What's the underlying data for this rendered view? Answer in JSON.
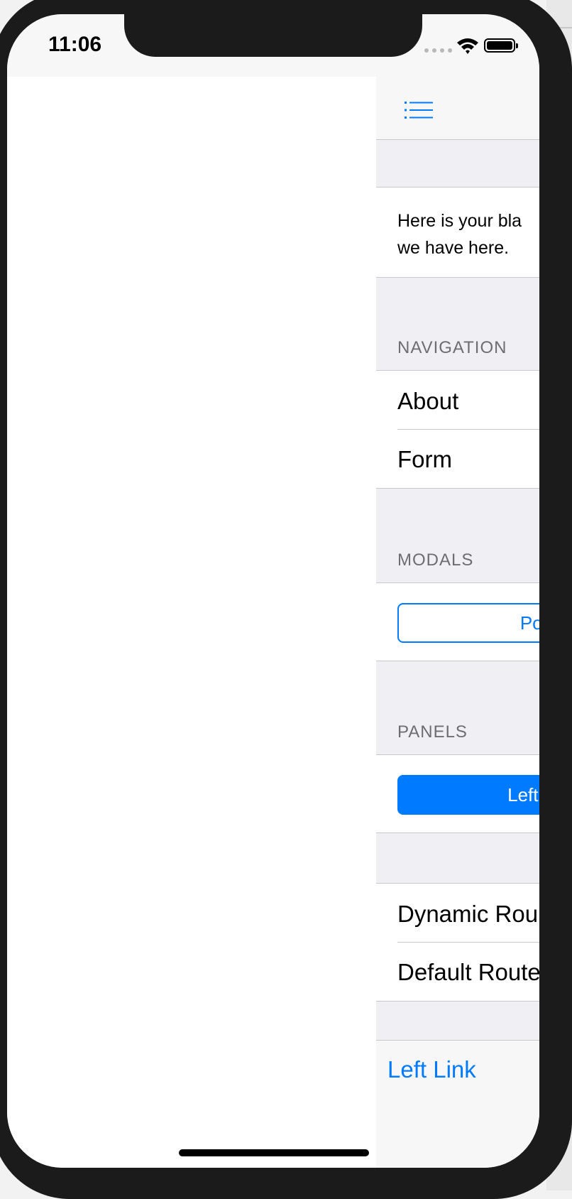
{
  "status_bar": {
    "time": "11:06"
  },
  "panel": {
    "block_text_lines": [
      "Here is your bla",
      "we have here."
    ],
    "sections": {
      "navigation": "NAVIGATION",
      "modals": "MODALS",
      "panels": "PANELS"
    },
    "navigation_items": [
      "About",
      "Form"
    ],
    "modals_button": "Popup",
    "panels_button": "Left Pan",
    "route_items": [
      "Dynamic Rou",
      "Default Route"
    ],
    "toolbar_link": "Left Link"
  },
  "colors": {
    "accent": "#007aff",
    "section_bg": "#efeff4",
    "bar_bg": "#f7f7f8",
    "section_text": "#6d6d72",
    "device_frame": "#1b1b1b"
  },
  "icons": [
    "menu-icon",
    "wifi-icon",
    "battery-icon",
    "cellular-signal-icon"
  ]
}
